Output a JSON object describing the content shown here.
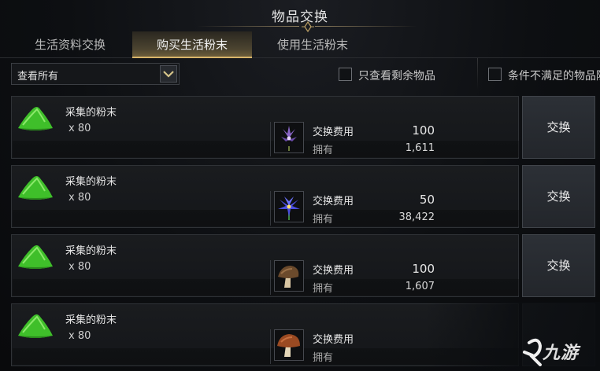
{
  "window": {
    "title": "物品交换"
  },
  "tabs": [
    {
      "label": "生活资料交换",
      "active": false
    },
    {
      "label": "购买生活粉末",
      "active": true
    },
    {
      "label": "使用生活粉末",
      "active": false
    }
  ],
  "filter": {
    "selected": "查看所有",
    "checkbox_remaining": "只查看剩余物品",
    "checkbox_unmet": "条件不满足的物品隐"
  },
  "labels": {
    "cost": "交换费用",
    "owned": "拥有",
    "exchange_button": "交换"
  },
  "rows": [
    {
      "item_name": "采集的粉末",
      "qty": "x 80",
      "cost_icon": "purple-flower-icon",
      "cost": "100",
      "owned": "1,611"
    },
    {
      "item_name": "采集的粉末",
      "qty": "x 80",
      "cost_icon": "blue-flower-icon",
      "cost": "50",
      "owned": "38,422"
    },
    {
      "item_name": "采集的粉末",
      "qty": "x 80",
      "cost_icon": "brown-mushroom-icon",
      "cost": "100",
      "owned": "1,607"
    },
    {
      "item_name": "采集的粉末",
      "qty": "x 80",
      "cost_icon": "red-mushroom-icon",
      "cost": "",
      "owned": ""
    }
  ],
  "watermark": {
    "text": "九游"
  },
  "colors": {
    "accent": "#d8b56a",
    "powder_green": "#3fbf2a"
  }
}
